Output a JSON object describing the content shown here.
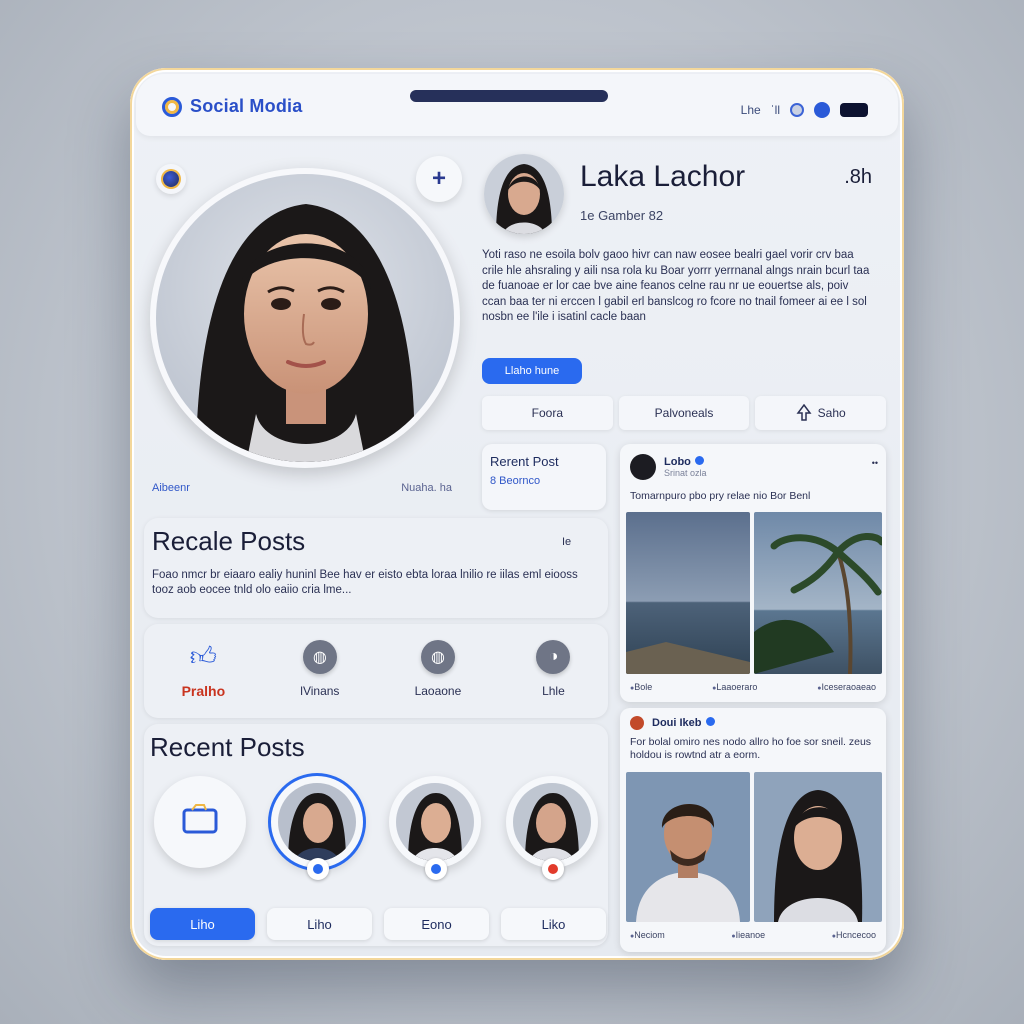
{
  "app": {
    "brand": "Social Modia"
  },
  "topbar": {
    "status_text": "Lhe",
    "status_num": "ˈll"
  },
  "profile": {
    "name": "Laka Lachor",
    "count": ".8h",
    "date": "1e Gamber 82",
    "bio": "Yoti raso ne esoila bolv gaoo hivr can naw eosee bealri gael vorir crv baa crile hle ahsraling y aili nsa rola ku Boar yorrr yerrnanal alngs nrain bcurl taa de fuanoae er lor cae bve aine feanos celne rau nr ue eouertse als, poiv ccan baa ter ni erccen l gabil erl banslcog ro fcore no  tnail fomeer ai ee l sol nosbn ee l'ile i isatinl cacle baan",
    "bio_button": "Llaho hune",
    "under_left": "Aibeenr",
    "under_right": "Nuaha. ha"
  },
  "actions": [
    {
      "label": "Foora"
    },
    {
      "label": "Palvoneals"
    },
    {
      "label": "Saho"
    }
  ],
  "recent_card": {
    "title": "Rerent Post",
    "subtitle": "8 Beornco"
  },
  "recale": {
    "title": "Recale Posts",
    "text": "Foao nmcr br eiaaro ealiy huninl Bee hav er eisto ebta loraa lnilio re iilas eml eiooss tooz aob eocee tnld olo eaiio cria lme...",
    "icon_label": "Ie"
  },
  "reactions": [
    {
      "label": "Pralho",
      "icon": "thumb-icon"
    },
    {
      "label": "lVinans",
      "icon": "circle-icon"
    },
    {
      "label": "Laoaone",
      "icon": "circle-icon"
    },
    {
      "label": "Lhle",
      "icon": "circle-icon"
    }
  ],
  "recent": {
    "title": "Recent Posts"
  },
  "buttons": [
    {
      "label": "Liho"
    },
    {
      "label": "Liho"
    },
    {
      "label": "Eono"
    },
    {
      "label": "Liko"
    }
  ],
  "feed": [
    {
      "name": "Lobo",
      "sub": "Srinat ozla",
      "text": "Tomarnpuro pbo pry relae nio Bor Benl",
      "foot": [
        "Bole",
        "Laaoeraro",
        "Iceseraoaeao"
      ]
    },
    {
      "name": "Doui Ikeb",
      "text": "For bolal omiro nes nodo allro ho foe sor sneil. zeus holdou is rowtnd atr a eorm.",
      "foot": [
        "Neciom",
        "Iieanoe",
        "Hcncecoo"
      ]
    }
  ],
  "colors": {
    "accent": "#2a6aef",
    "brand": "#2a4fc8",
    "rim": "#f3d79b"
  }
}
